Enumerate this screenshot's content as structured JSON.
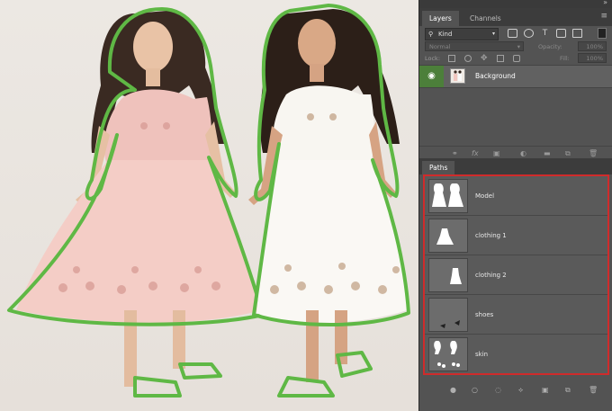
{
  "layers_panel": {
    "tabs": [
      {
        "label": "Layers",
        "active": true
      },
      {
        "label": "Channels",
        "active": false
      }
    ],
    "filter": {
      "kind_label": "Kind",
      "search_icon": "search-icon"
    },
    "blend_mode": "Normal",
    "opacity_label": "Opacity:",
    "opacity_value": "100%",
    "lock_label": "Lock:",
    "fill_label": "Fill:",
    "fill_value": "100%",
    "layers": [
      {
        "name": "Background",
        "visible": true
      }
    ],
    "footer_icons": [
      "link-icon",
      "fx-icon",
      "mask-icon",
      "adjustment-icon",
      "folder-icon",
      "new-layer-icon",
      "trash-icon"
    ]
  },
  "paths_panel": {
    "tab_label": "Paths",
    "paths": [
      {
        "name": "Model"
      },
      {
        "name": "clothing 1"
      },
      {
        "name": "clothing 2"
      },
      {
        "name": "shoes"
      },
      {
        "name": "skin"
      }
    ],
    "footer_icons": [
      "fill-path-icon",
      "stroke-path-icon",
      "load-selection-icon",
      "make-path-icon",
      "add-mask-icon",
      "new-path-icon",
      "trash-icon"
    ]
  },
  "colors": {
    "path_outline": "#5fb845",
    "highlight_border": "#d02b2b",
    "visibility_active": "#4c7f3a",
    "panel_bg": "#535353"
  }
}
